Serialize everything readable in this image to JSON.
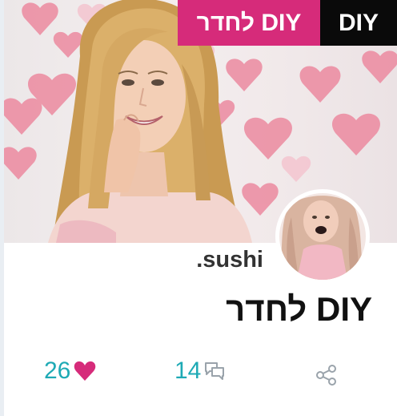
{
  "tags": {
    "primary": "DIY לחדר",
    "secondary": "DIY"
  },
  "author": {
    "username": ".sushi"
  },
  "post": {
    "title": "DIY לחדר"
  },
  "stats": {
    "likes": "26",
    "comments": "14"
  },
  "icons": {
    "like": "heart-icon",
    "comment": "comment-icon",
    "share": "share-icon"
  },
  "colors": {
    "tag_pink": "#d62b7a",
    "tag_black": "#0a0a0a",
    "stat_number": "#1eaab5",
    "heart": "#d62b7a"
  }
}
